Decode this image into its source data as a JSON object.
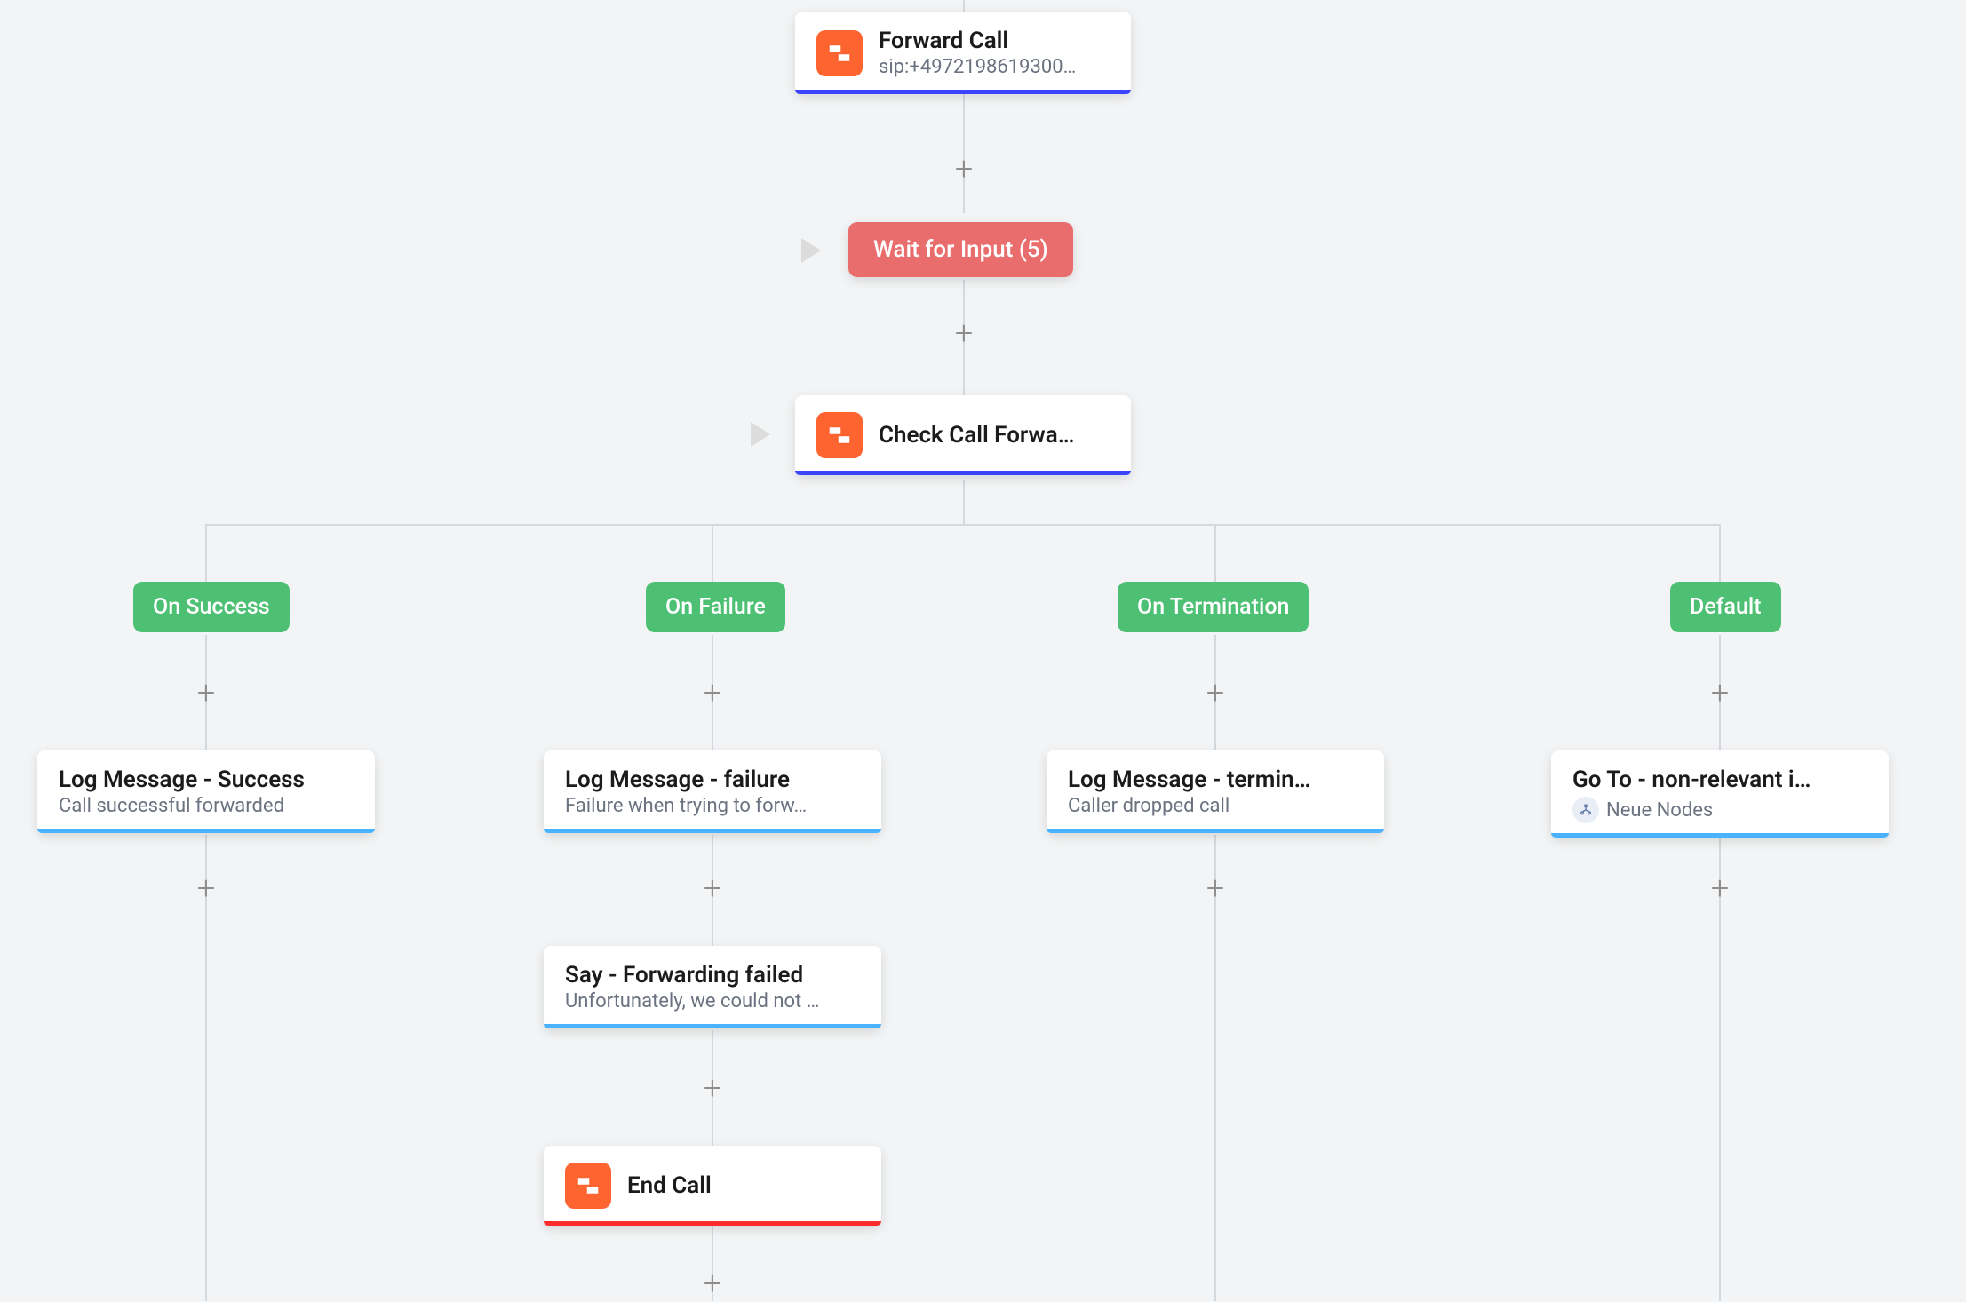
{
  "trunk": {
    "forward": {
      "title": "Forward Call",
      "subtitle": "sip:+4972198619300…"
    },
    "wait": {
      "label": "Wait for Input (5)"
    },
    "check": {
      "title": "Check Call Forwa…"
    }
  },
  "branches": {
    "success": {
      "tag": "On Success",
      "node": {
        "title": "Log Message - Success",
        "subtitle": "Call successful forwarded"
      }
    },
    "failure": {
      "tag": "On Failure",
      "nodes": [
        {
          "title": "Log Message - failure",
          "subtitle": "Failure when trying to forw…"
        },
        {
          "title": "Say - Forwarding failed",
          "subtitle": "Unfortunately, we could not …"
        },
        {
          "title": "End Call"
        }
      ]
    },
    "termination": {
      "tag": "On Termination",
      "node": {
        "title": "Log Message - termin…",
        "subtitle": "Caller dropped call"
      }
    },
    "default": {
      "tag": "Default",
      "node": {
        "title": "Go To - non-relevant i…",
        "sublabel": "Neue Nodes"
      }
    }
  },
  "colors": {
    "accent_blue": "#3c43ff",
    "accent_lightblue": "#49b3ff",
    "accent_red": "#ff2c2c",
    "tag_green": "#4dc073",
    "wait_red": "#e86d6c",
    "icon_orange": "#fd6430"
  }
}
